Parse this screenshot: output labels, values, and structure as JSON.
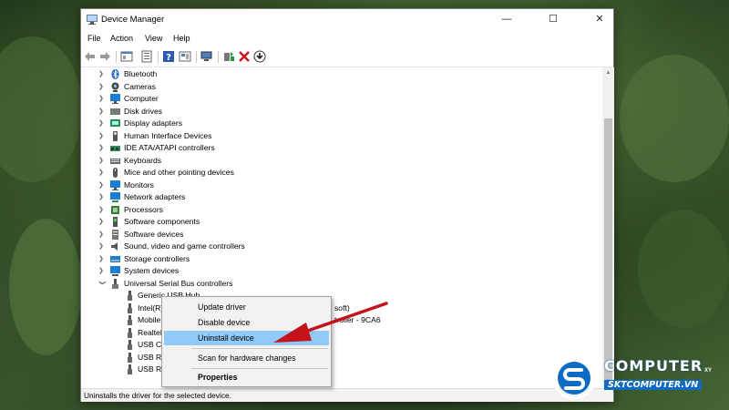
{
  "window": {
    "title": "Device Manager",
    "controls": {
      "minimize": "—",
      "maximize": "☐",
      "close": "✕"
    }
  },
  "menu": [
    "File",
    "Action",
    "View",
    "Help"
  ],
  "tree": {
    "categories": [
      {
        "label": "Bluetooth",
        "icon": "bluetooth-icon"
      },
      {
        "label": "Cameras",
        "icon": "camera-icon"
      },
      {
        "label": "Computer",
        "icon": "computer-icon"
      },
      {
        "label": "Disk drives",
        "icon": "disk-drive-icon"
      },
      {
        "label": "Display adapters",
        "icon": "display-adapter-icon"
      },
      {
        "label": "Human Interface Devices",
        "icon": "hid-icon"
      },
      {
        "label": "IDE ATA/ATAPI controllers",
        "icon": "ide-controller-icon"
      },
      {
        "label": "Keyboards",
        "icon": "keyboard-icon"
      },
      {
        "label": "Mice and other pointing devices",
        "icon": "mouse-icon"
      },
      {
        "label": "Monitors",
        "icon": "monitor-icon"
      },
      {
        "label": "Network adapters",
        "icon": "network-adapter-icon"
      },
      {
        "label": "Processors",
        "icon": "processor-icon"
      },
      {
        "label": "Software components",
        "icon": "software-component-icon"
      },
      {
        "label": "Software devices",
        "icon": "software-device-icon"
      },
      {
        "label": "Sound, video and game controllers",
        "icon": "sound-icon"
      },
      {
        "label": "Storage controllers",
        "icon": "storage-controller-icon"
      },
      {
        "label": "System devices",
        "icon": "system-device-icon"
      },
      {
        "label": "Universal Serial Bus controllers",
        "icon": "usb-controller-icon"
      }
    ],
    "usb_children": [
      {
        "label": "Generic USB Hub",
        "suffix": ""
      },
      {
        "label": "Intel(R) US",
        "suffix": "soft)"
      },
      {
        "label": "Mobile Stl",
        "suffix": "troller - 9CA6"
      },
      {
        "label": "Realtek US",
        "suffix": ""
      },
      {
        "label": "USB Comp",
        "suffix": ""
      },
      {
        "label": "USB Root",
        "suffix": ""
      },
      {
        "label": "USB Root",
        "suffix": ""
      }
    ]
  },
  "context_menu": {
    "items": [
      "Update driver",
      "Disable device",
      "Uninstall device",
      "Scan for hardware changes",
      "Properties"
    ],
    "highlighted": "Uninstall device"
  },
  "status_bar": {
    "text": "Uninstalls the driver for the selected device."
  },
  "logo": {
    "brand": "COMPUTER",
    "site": "SKTCOMPUTER.VN",
    "mark": "XY"
  },
  "colors": {
    "highlight": "#91c9f7",
    "arrow": "#c4131a",
    "brand": "#0d6cc1"
  }
}
